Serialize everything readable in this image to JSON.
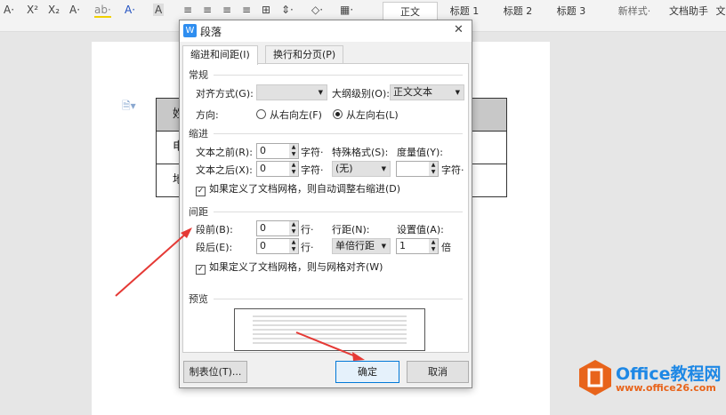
{
  "toolbar": {
    "font_tools": [
      "A·",
      "X²",
      "X₂",
      "A·",
      "ab·",
      "A·",
      "A"
    ],
    "para_tools": [
      "≡",
      "≡",
      "≡",
      "≡",
      "⊞",
      "⇕·",
      "◇·",
      "▦·"
    ],
    "styles": [
      "正文",
      "标题 1",
      "标题 2",
      "标题 3"
    ],
    "new_style": "新样式·",
    "doc_helper": "文档助手",
    "more": "文"
  },
  "document": {
    "table_cells": [
      "姓",
      "电",
      "地"
    ]
  },
  "dialog": {
    "title": "段落",
    "close": "✕",
    "tabs": [
      "缩进和间距(I)",
      "换行和分页(P)"
    ],
    "general": {
      "heading": "常规",
      "align_label": "对齐方式(G):",
      "align_value": "",
      "outline_label": "大纲级别(O):",
      "outline_value": "正文文本",
      "direction_label": "方向:",
      "rtl": "从右向左(F)",
      "ltr": "从左向右(L)"
    },
    "indent": {
      "heading": "缩进",
      "before_label": "文本之前(R):",
      "before_value": "0",
      "after_label": "文本之后(X):",
      "after_value": "0",
      "unit": "字符·",
      "special_label": "特殊格式(S):",
      "special_value": "(无)",
      "measure_label": "度量值(Y):",
      "measure_value": "",
      "measure_unit": "字符·",
      "auto_adjust": "如果定义了文档网格，则自动调整右缩进(D)"
    },
    "spacing": {
      "heading": "间距",
      "before_label": "段前(B):",
      "before_value": "0",
      "after_label": "段后(E):",
      "after_value": "0",
      "unit": "行·",
      "line_label": "行距(N):",
      "line_value": "单倍行距",
      "set_label": "设置值(A):",
      "set_value": "1",
      "set_unit": "倍",
      "snap_grid": "如果定义了文档网格，则与网格对齐(W)"
    },
    "preview": {
      "heading": "预览"
    },
    "buttons": {
      "tabs": "制表位(T)...",
      "ok": "确定",
      "cancel": "取消"
    }
  },
  "watermark": {
    "brand": "Office教程网",
    "url": "www.office26.com"
  },
  "colors": {
    "accent": "#e8641b",
    "brand_blue": "#1e88e5",
    "arrow": "#e53935"
  }
}
